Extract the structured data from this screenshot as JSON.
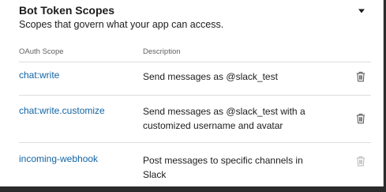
{
  "section": {
    "title": "Bot Token Scopes",
    "subtitle": "Scopes that govern what your app can access."
  },
  "table": {
    "columns": {
      "scope": "OAuth Scope",
      "description": "Description"
    },
    "rows": [
      {
        "scope": "chat:write",
        "description": "Send messages as @slack_test",
        "remove_enabled": true
      },
      {
        "scope": "chat:write.customize",
        "description": "Send messages as @slack_test with a customized username and avatar",
        "remove_enabled": true
      },
      {
        "scope": "incoming-webhook",
        "description": "Post messages to specific channels in Slack",
        "remove_enabled": false
      }
    ]
  },
  "icons": {
    "collapse": "caret-down-icon",
    "remove": "trash-icon"
  },
  "colors": {
    "link": "#1264a3",
    "text": "#1d1c1d",
    "muted": "#616061",
    "trash_enabled": "#616061",
    "trash_disabled": "#bdbdbd"
  }
}
